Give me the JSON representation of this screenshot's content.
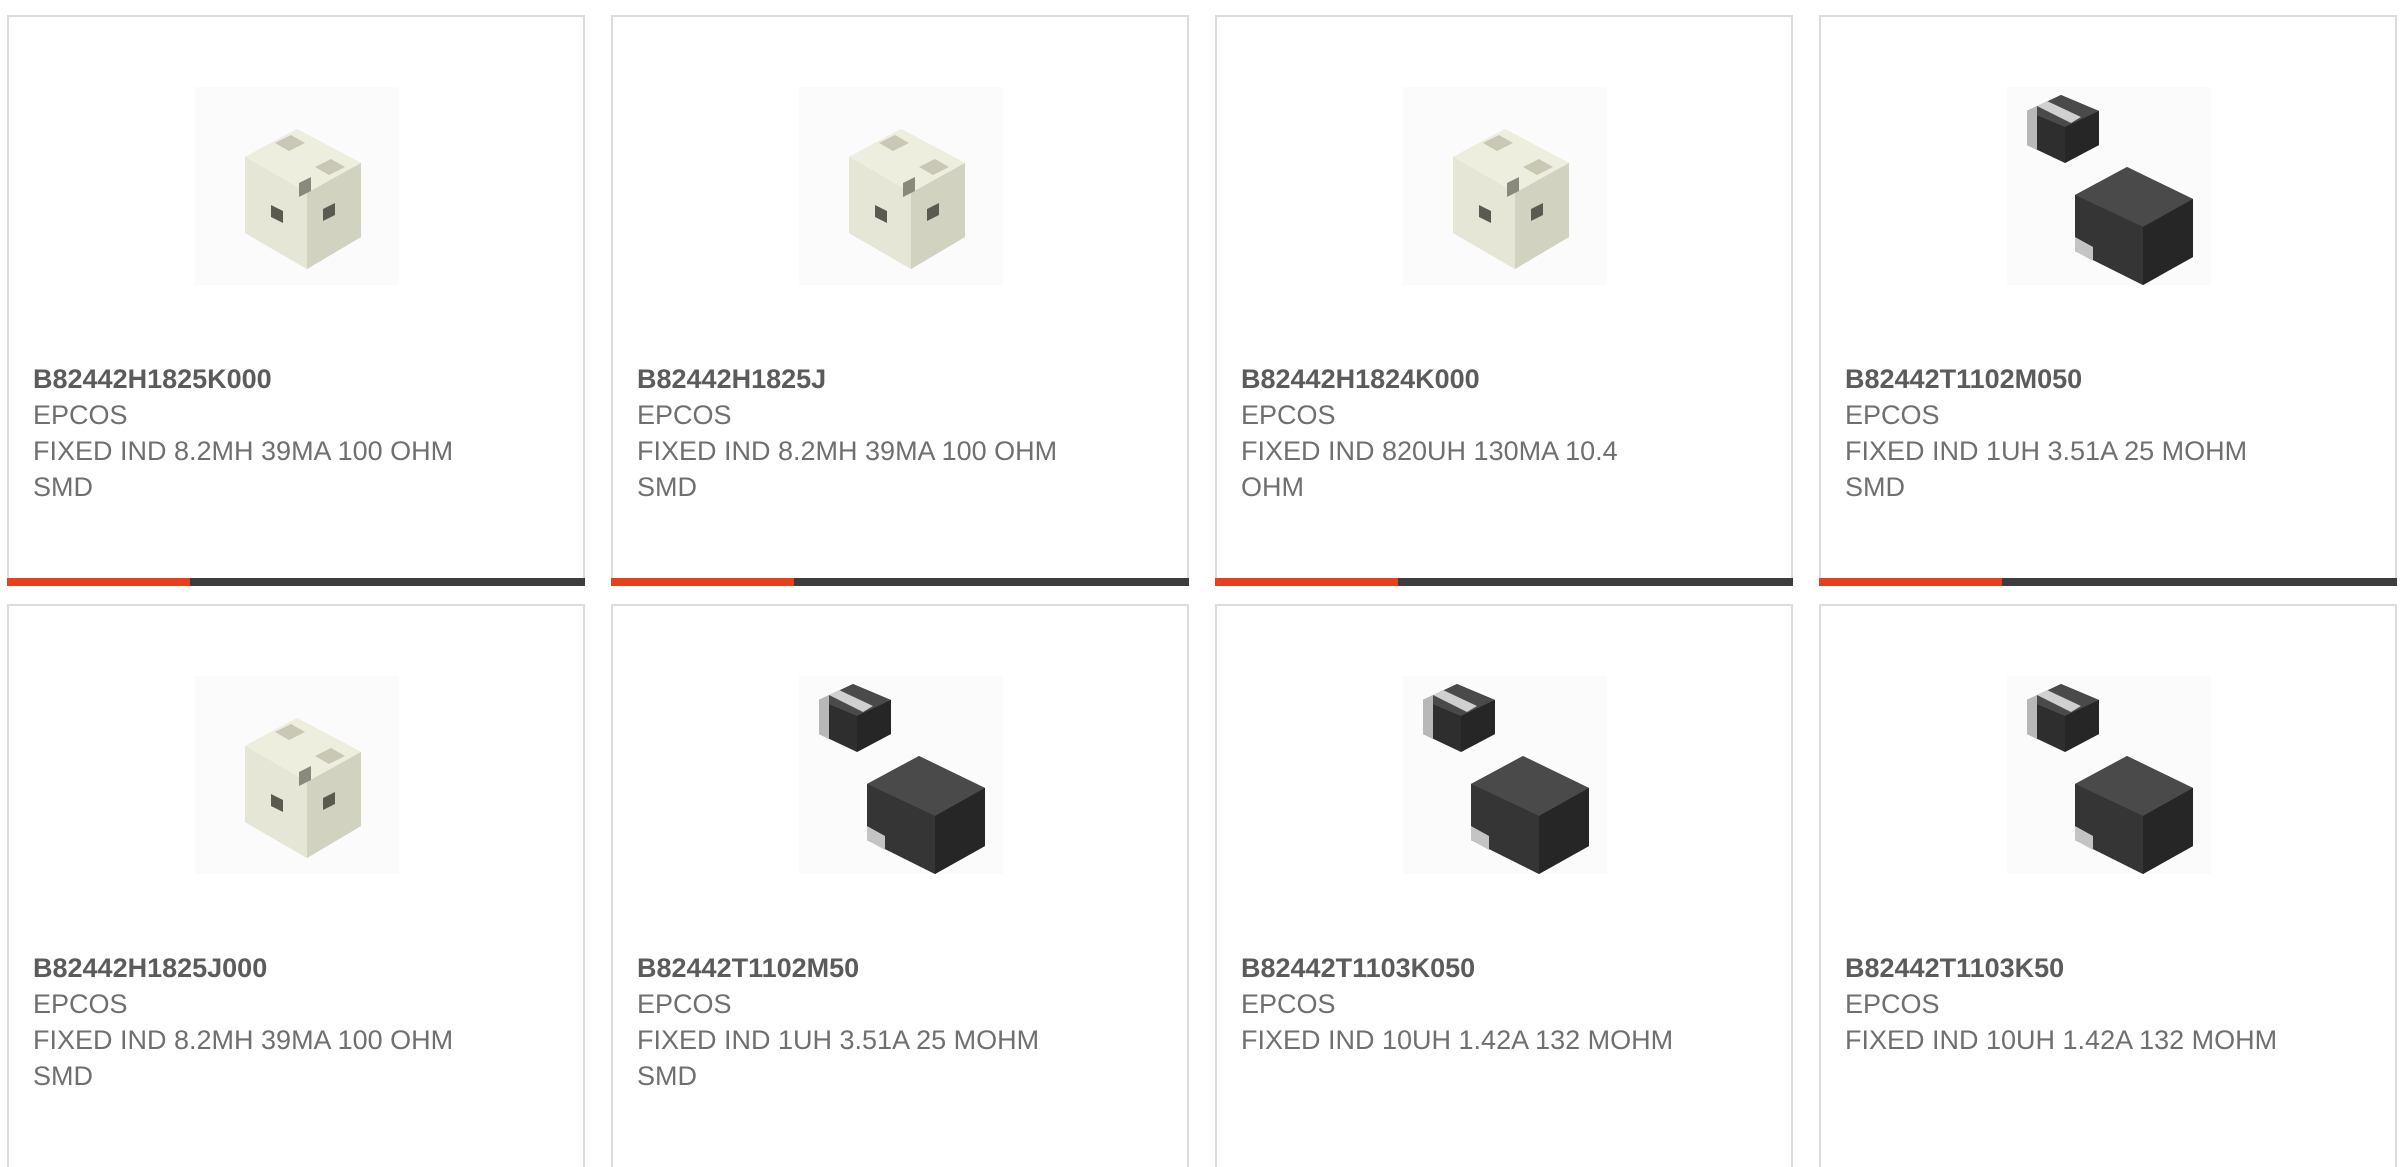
{
  "accent_color": "#e8401c",
  "bar_color": "#3d3d3d",
  "products": [
    {
      "part_number": "B82442H1825K000",
      "manufacturer": "EPCOS",
      "description": "FIXED IND 8.2MH 39MA 100 OHM SMD",
      "image": "white-inductor-icon"
    },
    {
      "part_number": "B82442H1825J",
      "manufacturer": "EPCOS",
      "description": "FIXED IND 8.2MH 39MA 100 OHM SMD",
      "image": "white-inductor-icon"
    },
    {
      "part_number": "B82442H1824K000",
      "manufacturer": "EPCOS",
      "description": "FIXED IND 820UH 130MA 10.4 OHM",
      "image": "white-inductor-icon"
    },
    {
      "part_number": "B82442T1102M050",
      "manufacturer": "EPCOS",
      "description": "FIXED IND 1UH 3.51A 25 MOHM SMD",
      "image": "black-inductor-icon"
    },
    {
      "part_number": "B82442H1825J000",
      "manufacturer": "EPCOS",
      "description": "FIXED IND 8.2MH 39MA 100 OHM SMD",
      "image": "white-inductor-icon"
    },
    {
      "part_number": "B82442T1102M50",
      "manufacturer": "EPCOS",
      "description": "FIXED IND 1UH 3.51A 25 MOHM SMD",
      "image": "black-inductor-icon"
    },
    {
      "part_number": "B82442T1103K050",
      "manufacturer": "EPCOS",
      "description": "FIXED IND 10UH 1.42A 132 MOHM",
      "image": "black-inductor-icon"
    },
    {
      "part_number": "B82442T1103K50",
      "manufacturer": "EPCOS",
      "description": "FIXED IND 10UH 1.42A 132 MOHM",
      "image": "black-inductor-icon"
    }
  ]
}
